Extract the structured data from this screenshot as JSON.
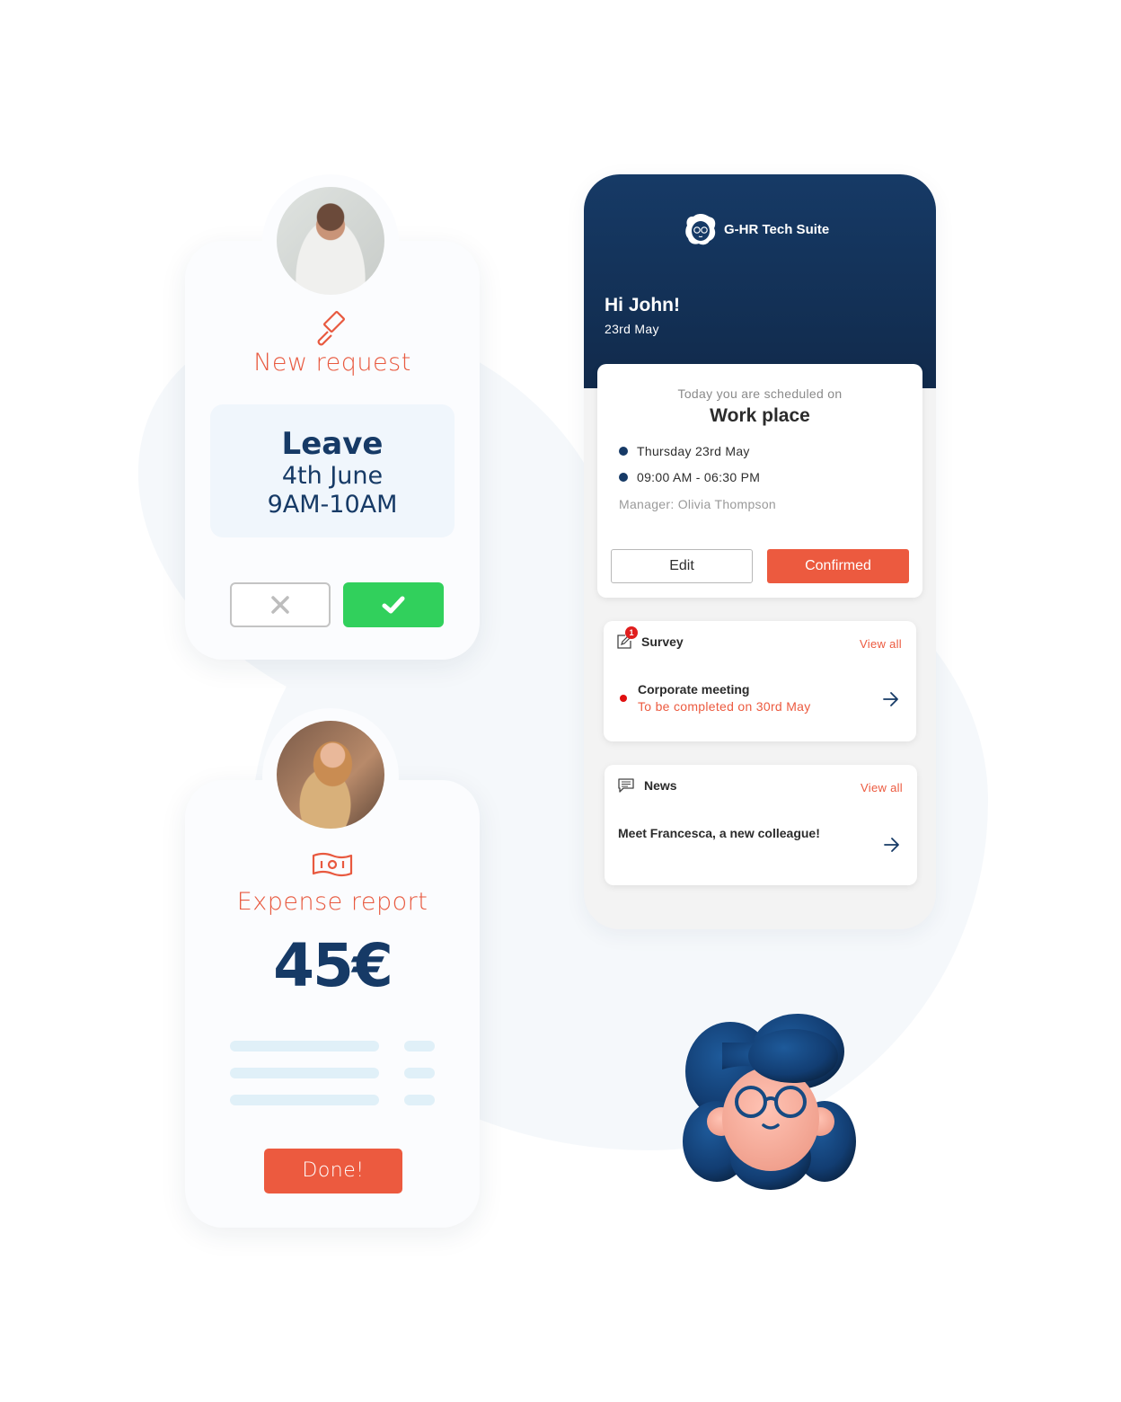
{
  "request_card": {
    "title": "New request",
    "icon": "gavel-icon",
    "leave": {
      "type": "Leave",
      "date": "4th June",
      "time": "9AM-10AM"
    },
    "reject_icon": "close-icon",
    "accept_icon": "check-icon"
  },
  "expense_card": {
    "title": "Expense report",
    "icon": "banknote-icon",
    "amount": "45€",
    "done_label": "Done!"
  },
  "phone": {
    "brand": "G-HR Tech Suite",
    "greeting": "Hi John!",
    "date": "23rd May",
    "schedule": {
      "subtitle": "Today you are scheduled on",
      "location": "Work place",
      "day": "Thursday 23rd May",
      "hours": "09:00 AM - 06:30 PM",
      "manager": "Manager: Olivia Thompson",
      "edit_label": "Edit",
      "confirmed_label": "Confirmed"
    },
    "survey": {
      "title": "Survey",
      "badge_count": "1",
      "view_all": "View all",
      "item_name": "Corporate meeting",
      "item_due": "To be completed on 30rd May"
    },
    "news": {
      "title": "News",
      "view_all": "View all",
      "item": "Meet Francesca, a new colleague!"
    }
  },
  "colors": {
    "accent": "#ec5a3f",
    "navy": "#163a66",
    "success": "#31d05c"
  }
}
